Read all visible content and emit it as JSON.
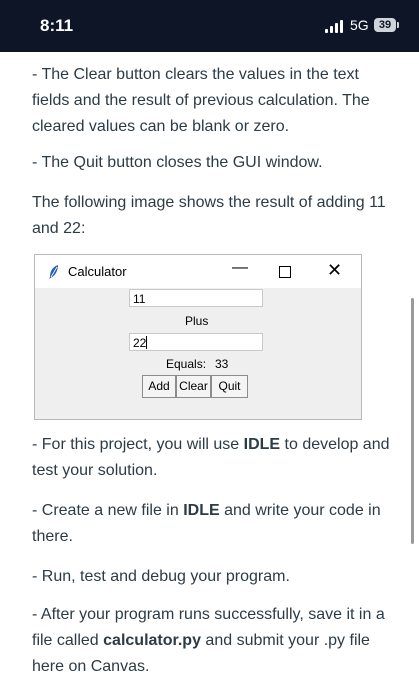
{
  "status_bar": {
    "time": "8:11",
    "network": "5G",
    "battery": "39"
  },
  "content": {
    "p1": "- The Clear button clears the values in the text fields and the result of previous calculation. The cleared values can be blank or zero.",
    "p2": "- The Quit button closes the GUI window.",
    "p3": "The following image shows the result of adding 11 and 22:",
    "p4_before": "- For this project, you will use ",
    "p4_bold": "IDLE",
    "p4_after": " to develop and test your solution.",
    "p5_before": "- Create a new file in ",
    "p5_bold": "IDLE",
    "p5_after": " and write your code in there.",
    "p6": "- Run, test and debug your program.",
    "p7_before": "- After your program runs successfully, save it in a file called ",
    "p7_bold": "calculator.py",
    "p7_after": " and submit your .py file here on Canvas."
  },
  "calculator_window": {
    "title": "Calculator",
    "minimize_glyph": "—",
    "close_glyph": "✕",
    "field1_value": "11",
    "operation_label": "Plus",
    "field2_value": "22",
    "equals_label": "Equals:",
    "result_value": "33",
    "add_label": "Add",
    "clear_label": "Clear",
    "quit_label": "Quit"
  },
  "icons": {
    "feather": "feather-icon",
    "signal": "signal-bars-icon",
    "battery": "battery-icon"
  }
}
